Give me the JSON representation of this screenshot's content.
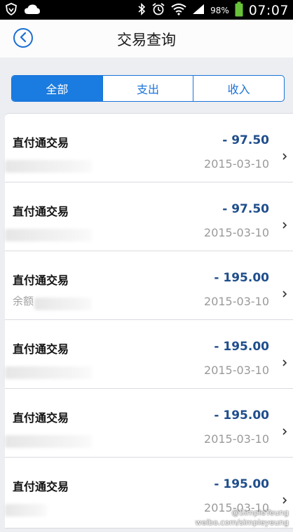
{
  "status_bar": {
    "battery_pct": "98%",
    "time": "07:07"
  },
  "header": {
    "title": "交易查询",
    "back_icon": "back-arrow-icon"
  },
  "tabs": [
    {
      "label": "全部",
      "active": true
    },
    {
      "label": "支出",
      "active": false
    },
    {
      "label": "收入",
      "active": false
    }
  ],
  "transactions": [
    {
      "title": "直付通交易",
      "amount": "- 97.50",
      "sub": "",
      "date": "2015-03-10"
    },
    {
      "title": "直付通交易",
      "amount": "- 97.50",
      "sub": "",
      "date": "2015-03-10"
    },
    {
      "title": "直付通交易",
      "amount": "- 195.00",
      "sub": "余额",
      "date": "2015-03-10"
    },
    {
      "title": "直付通交易",
      "amount": "- 195.00",
      "sub": "",
      "date": "2015-03-10"
    },
    {
      "title": "直付通交易",
      "amount": "- 195.00",
      "sub": "",
      "date": "2015-03-10"
    },
    {
      "title": "直付通交易",
      "amount": "- 195.00",
      "sub": "",
      "date": "2015-03-10"
    }
  ],
  "watermark": {
    "line1": "@SimpleYeung",
    "line2": "weibo.com/simpleyeung"
  },
  "colors": {
    "accent": "#1a7be0",
    "amount": "#1f4e8c",
    "status_bar": "#000000"
  }
}
